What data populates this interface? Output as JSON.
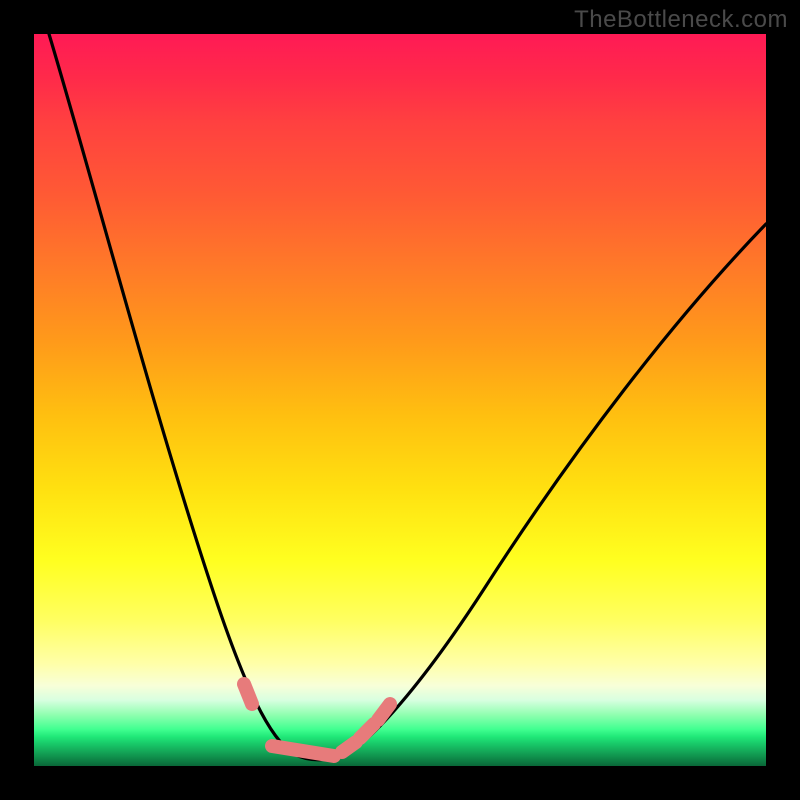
{
  "watermark": "TheBottleneck.com",
  "colors": {
    "frame": "#000000",
    "curve": "#000000",
    "marker": "#e77b7b"
  },
  "chart_data": {
    "type": "line",
    "title": "",
    "xlabel": "",
    "ylabel": "",
    "xlim": [
      0,
      100
    ],
    "ylim": [
      0,
      100
    ],
    "series": [
      {
        "name": "bottleneck-curve",
        "x": [
          2,
          5,
          8,
          11,
          14,
          17,
          20,
          23,
          26,
          28,
          30,
          32,
          34,
          36,
          38,
          40,
          42,
          44,
          46,
          50,
          55,
          60,
          65,
          70,
          75,
          80,
          85,
          90,
          95,
          100
        ],
        "y": [
          100,
          91,
          82,
          73,
          64,
          55,
          46,
          37,
          28,
          21,
          15,
          10,
          6,
          3,
          1.5,
          1,
          1.5,
          3,
          6,
          12,
          20,
          27,
          34,
          41,
          48,
          54,
          60,
          66,
          71,
          76
        ]
      }
    ],
    "markers": {
      "name": "highlight-region",
      "x": [
        30,
        32,
        34,
        36,
        38,
        40,
        42,
        44
      ],
      "y": [
        15,
        10,
        6,
        3,
        1.5,
        1,
        1.5,
        6
      ]
    },
    "annotations": []
  }
}
